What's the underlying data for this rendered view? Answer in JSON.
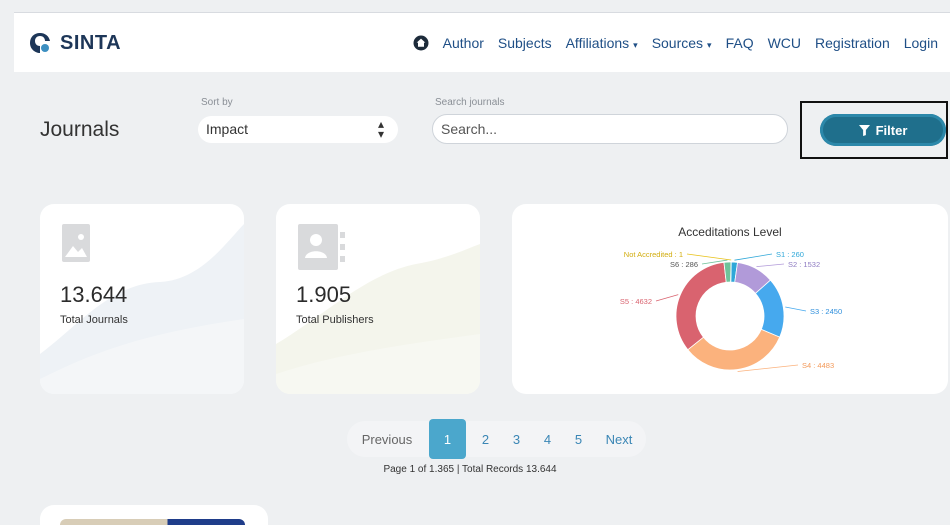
{
  "navbar": {
    "brand": "SINTA",
    "links": [
      {
        "label": "Author"
      },
      {
        "label": "Subjects"
      },
      {
        "label": "Affiliations",
        "dropdown": true
      },
      {
        "label": "Sources",
        "dropdown": true
      },
      {
        "label": "FAQ"
      },
      {
        "label": "WCU"
      },
      {
        "label": "Registration"
      },
      {
        "label": "Login"
      }
    ],
    "caret": "▾"
  },
  "page": {
    "title": "Journals"
  },
  "controls": {
    "sort_label": "Sort by",
    "sort_value": "Impact",
    "search_label": "Search journals",
    "search_placeholder": "Search...",
    "filter_label": "Filter"
  },
  "stats": [
    {
      "value": "13.644",
      "label": "Total Journals"
    },
    {
      "value": "1.905",
      "label": "Total Publishers"
    }
  ],
  "chart_data": {
    "type": "pie",
    "title": "Acceditations Level",
    "slices": [
      {
        "label": "S1 : 260",
        "name": "S1",
        "value": 260,
        "color": "#2ea7d8"
      },
      {
        "label": "S2 : 1532",
        "name": "S2",
        "value": 1532,
        "color": "#b19ad9"
      },
      {
        "label": "S3 : 2450",
        "name": "S3",
        "value": 2450,
        "color": "#46a9ee"
      },
      {
        "label": "S4 : 4483",
        "name": "S4",
        "value": 4483,
        "color": "#fbb27d"
      },
      {
        "label": "S5 : 4632",
        "name": "S5",
        "value": 4632,
        "color": "#d9636f"
      },
      {
        "label": "S6 : 286",
        "name": "S6",
        "value": 286,
        "color": "#6fc39a"
      },
      {
        "label": "Not Accredited : 1",
        "name": "Not Accredited",
        "value": 1,
        "color": "#e8c21a"
      }
    ],
    "donut": true
  },
  "pagination": {
    "previous": "Previous",
    "pages": [
      "1",
      "2",
      "3",
      "4",
      "5"
    ],
    "active": "1",
    "next": "Next",
    "info": "Page 1 of 1.365 | Total Records 13.644"
  },
  "colors": {
    "primary": "#1f6f8c",
    "link": "#1f4f86",
    "active_page": "#4ba7cc"
  }
}
